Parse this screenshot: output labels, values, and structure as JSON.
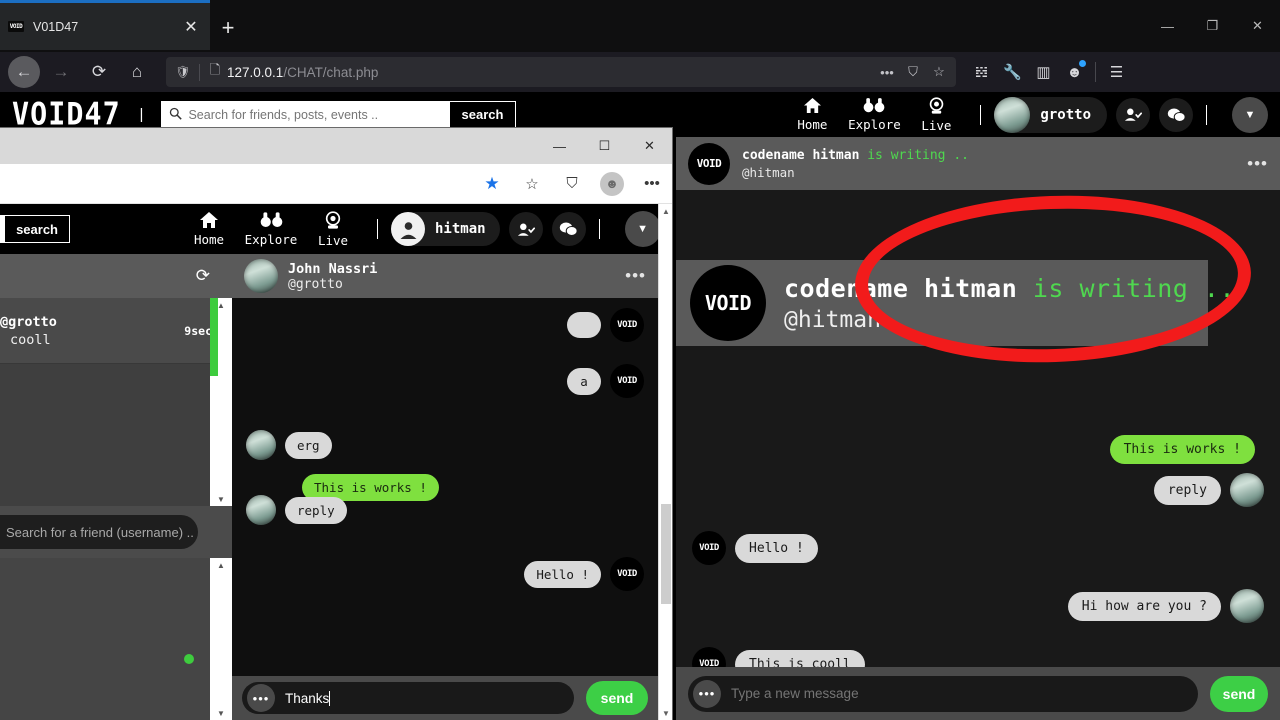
{
  "browser": {
    "tab": {
      "title": "V01D47",
      "favicon_label": "VOID",
      "close_icon": "✕"
    },
    "new_tab_icon": "+",
    "window_controls": {
      "minimize": "—",
      "maximize": "❐",
      "close": "✕"
    },
    "nav": {
      "back": "←",
      "forward": "→",
      "reload": "⟳",
      "home": "⌂"
    },
    "url": {
      "protocol_shield_icon": "🛡",
      "page_icon": "🗋",
      "host": "127.0.0.1",
      "path": "/CHAT/chat.php",
      "more_icon": "•••",
      "pocket_icon": "⛉",
      "bookmark_icon": "☆"
    },
    "toolbar": {
      "library_icon": "𝍌",
      "tools_icon": "🔧",
      "sidebar_icon": "▥",
      "account_icon": "☻",
      "menu_icon": "☰"
    }
  },
  "site": {
    "logo": "VOID47",
    "divider": "|",
    "search": {
      "placeholder": "Search for friends, posts, events ..",
      "value": "",
      "button_label": "search",
      "icon": "search-icon"
    },
    "nav_items": [
      {
        "label": "Home",
        "icon": "home-icon"
      },
      {
        "label": "Explore",
        "icon": "binoculars-icon"
      },
      {
        "label": "Live",
        "icon": "live-icon"
      }
    ],
    "user": {
      "name": "grotto"
    },
    "actions": {
      "add_friend": "add-friend-icon",
      "messages": "messages-icon",
      "caret": "▼"
    }
  },
  "right_panel": {
    "header": {
      "avatar_label": "VOID",
      "name": "codename hitman",
      "status": "is writing ..",
      "handle": "@hitman",
      "more_icon": "•••"
    },
    "messages": [
      {
        "side": "right",
        "text": "This is works !",
        "style": "green",
        "avatar": "user"
      },
      {
        "side": "right",
        "text": "reply",
        "style": "gray",
        "avatar": "user"
      },
      {
        "side": "left",
        "text": "Hello !",
        "style": "gray",
        "avatar": "void"
      },
      {
        "side": "right",
        "text": "Hi how are you ?",
        "style": "gray",
        "avatar": "user"
      },
      {
        "side": "left",
        "text": "This is cooll",
        "style": "gray",
        "avatar": "void"
      }
    ],
    "input": {
      "placeholder": "Type a new message",
      "value": "",
      "send_label": "send",
      "dots_icon": "•••"
    }
  },
  "callout": {
    "avatar_label": "VOID",
    "name": "codename hitman",
    "status": "is writing ..",
    "handle": "@hitman",
    "highlight_color": "#f21b1b"
  },
  "inner_window": {
    "window_controls": {
      "minimize": "—",
      "maximize": "☐",
      "close": "✕"
    },
    "toolbar": {
      "star_filled": "★",
      "star_outline": "☆",
      "collections": "⛉",
      "profile": "☻",
      "more": "•••"
    },
    "site": {
      "search_button_label": "search",
      "nav_items": [
        {
          "label": "Home",
          "icon": "home-icon"
        },
        {
          "label": "Explore",
          "icon": "binoculars-icon"
        },
        {
          "label": "Live",
          "icon": "live-icon"
        }
      ],
      "user": {
        "name": "hitman"
      },
      "actions": {
        "add_friend": "add-friend-icon",
        "messages": "messages-icon",
        "caret": "▼"
      }
    },
    "left_panel": {
      "refresh_icon": "⟳",
      "conversations": [
        {
          "name": "@grotto",
          "message": "cooll",
          "time": "9sec"
        }
      ],
      "friend_search_placeholder": "Search for a friend (username) ..",
      "scroll_up": "▲",
      "scroll_down": "▼"
    },
    "chat": {
      "header": {
        "name": "John Nassri",
        "handle": "@grotto",
        "more_icon": "•••"
      },
      "messages": [
        {
          "side": "right",
          "text": "",
          "style": "gray",
          "avatar": "void"
        },
        {
          "side": "right",
          "text": "a",
          "style": "gray",
          "avatar": "void"
        },
        {
          "side": "left",
          "text": "erg",
          "style": "gray",
          "avatar": "user"
        },
        {
          "side": "right-inline",
          "text": "This is works !",
          "style": "green",
          "avatar": "none"
        },
        {
          "side": "left",
          "text": "reply",
          "style": "gray",
          "avatar": "user"
        },
        {
          "side": "right",
          "text": "Hello !",
          "style": "gray",
          "avatar": "void"
        }
      ],
      "input": {
        "placeholder": "",
        "value": "Thanks",
        "send_label": "send",
        "dots_icon": "•••"
      }
    }
  },
  "colors": {
    "accent_green": "#7fe03f",
    "send_green": "#3dcf46",
    "status_green": "#4fd84f",
    "highlight_red": "#f21b1b",
    "panel_bg": "#191919",
    "header_gray": "#5a5a5a"
  }
}
